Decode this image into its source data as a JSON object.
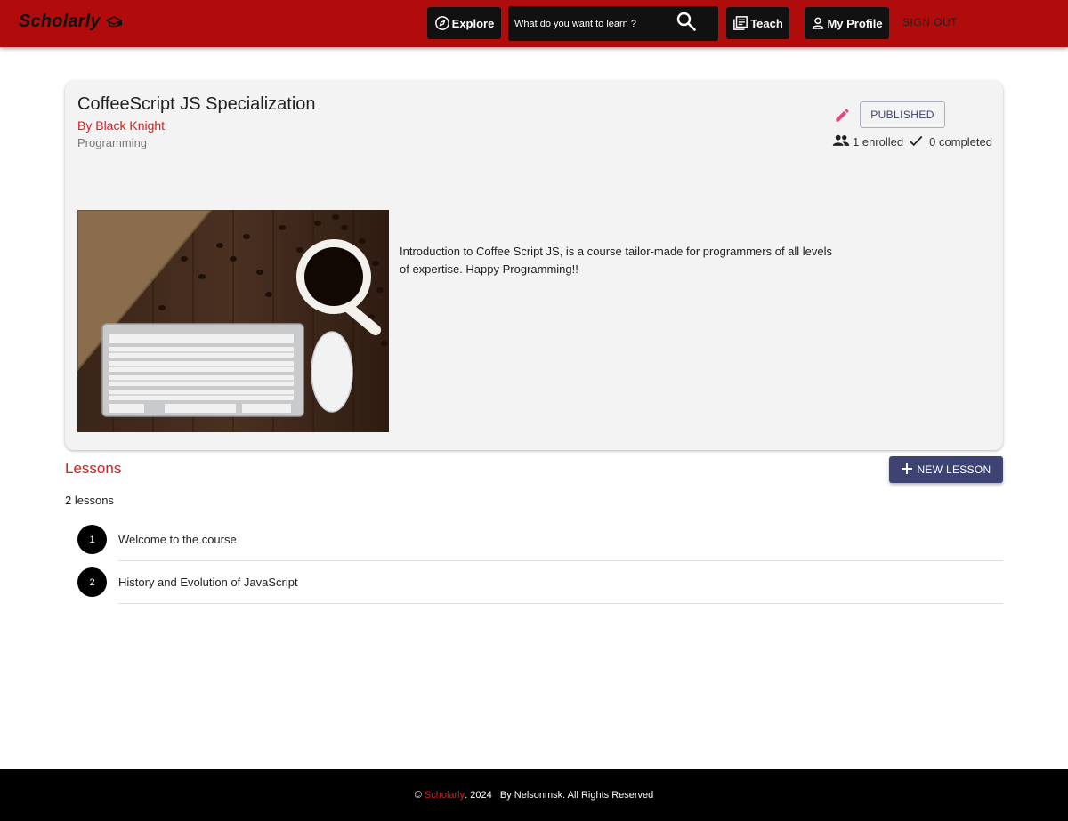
{
  "header": {
    "brand": "Scholarly",
    "brand_icon": "graduation-cap-icon",
    "explore_label": "Explore",
    "search_placeholder": "What do you want to learn ?",
    "teach_label": "Teach",
    "profile_label": "My Profile",
    "signout_label": "SIGN OUT",
    "bar_color": "#b00c0c"
  },
  "course": {
    "title": "CoffeeScript JS Specialization",
    "author": "By Black Knight",
    "category": "Programming",
    "status_label": "PUBLISHED",
    "enrolled_text": "1 enrolled",
    "completed_text": "0 completed",
    "description": "Introduction to Coffee Script JS, is a course tailor-made for programmers of all levels of expertise. Happy Programming!!",
    "image": "keyboard-mouse-coffee-photo"
  },
  "lessons": {
    "title": "Lessons",
    "new_button_label": "NEW LESSON",
    "count_text": "2 lessons",
    "items": [
      {
        "number": "1",
        "label": "Welcome to the course"
      },
      {
        "number": "2",
        "label": "History and Evolution of JavaScript"
      }
    ]
  },
  "footer": {
    "copyright": "© ",
    "brand": "Scholarly",
    "rest": ". 2024   By Nelsonmsk. All Rights Reserved"
  },
  "colors": {
    "accent_red": "#d42020",
    "primary_button": "#3d4474",
    "edit_icon": "#e8457a"
  }
}
